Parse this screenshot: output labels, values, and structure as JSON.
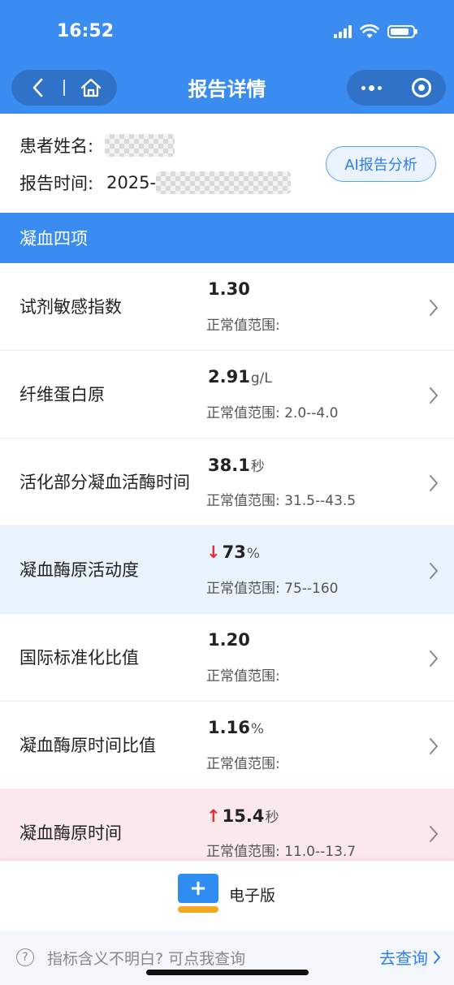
{
  "status_bar": {
    "time": "16:52"
  },
  "nav": {
    "title": "报告详情"
  },
  "patient": {
    "name_label": "患者姓名:",
    "time_label": "报告时间:",
    "time_value": "2025-",
    "ai_button": "AI报告分析"
  },
  "section": {
    "title": "凝血四项"
  },
  "items": [
    {
      "name": "试剂敏感指数",
      "arrow": "",
      "value": "1.30",
      "unit": "",
      "range": "正常值范围:",
      "status": "normal"
    },
    {
      "name": "纤维蛋白原",
      "arrow": "",
      "value": "2.91",
      "unit": "g/L",
      "range": "正常值范围: 2.0--4.0",
      "status": "normal"
    },
    {
      "name": "活化部分凝血活酶时间",
      "arrow": "",
      "value": "38.1",
      "unit": "秒",
      "range": "正常值范围: 31.5--43.5",
      "status": "normal"
    },
    {
      "name": "凝血酶原活动度",
      "arrow": "↓",
      "value": "73",
      "unit": "%",
      "range": "正常值范围: 75--160",
      "status": "low"
    },
    {
      "name": "国际标准化比值",
      "arrow": "",
      "value": "1.20",
      "unit": "",
      "range": "正常值范围:",
      "status": "normal"
    },
    {
      "name": "凝血酶原时间比值",
      "arrow": "",
      "value": "1.16",
      "unit": "%",
      "range": "正常值范围:",
      "status": "normal"
    },
    {
      "name": "凝血酶原时间",
      "arrow": "↑",
      "value": "15.4",
      "unit": "秒",
      "range": "正常值范围: 11.0--13.7",
      "status": "high"
    }
  ],
  "electronic": {
    "label": "电子版",
    "icon": "plus-icon"
  },
  "help": {
    "text": "指标含义不明白? 可点我查询",
    "action": "去查询"
  },
  "colors": {
    "primary": "#3b8cf0",
    "low_bg": "#e8f3fe",
    "high_bg": "#fbe8ea",
    "abnormal_arrow": "#e0303a"
  }
}
